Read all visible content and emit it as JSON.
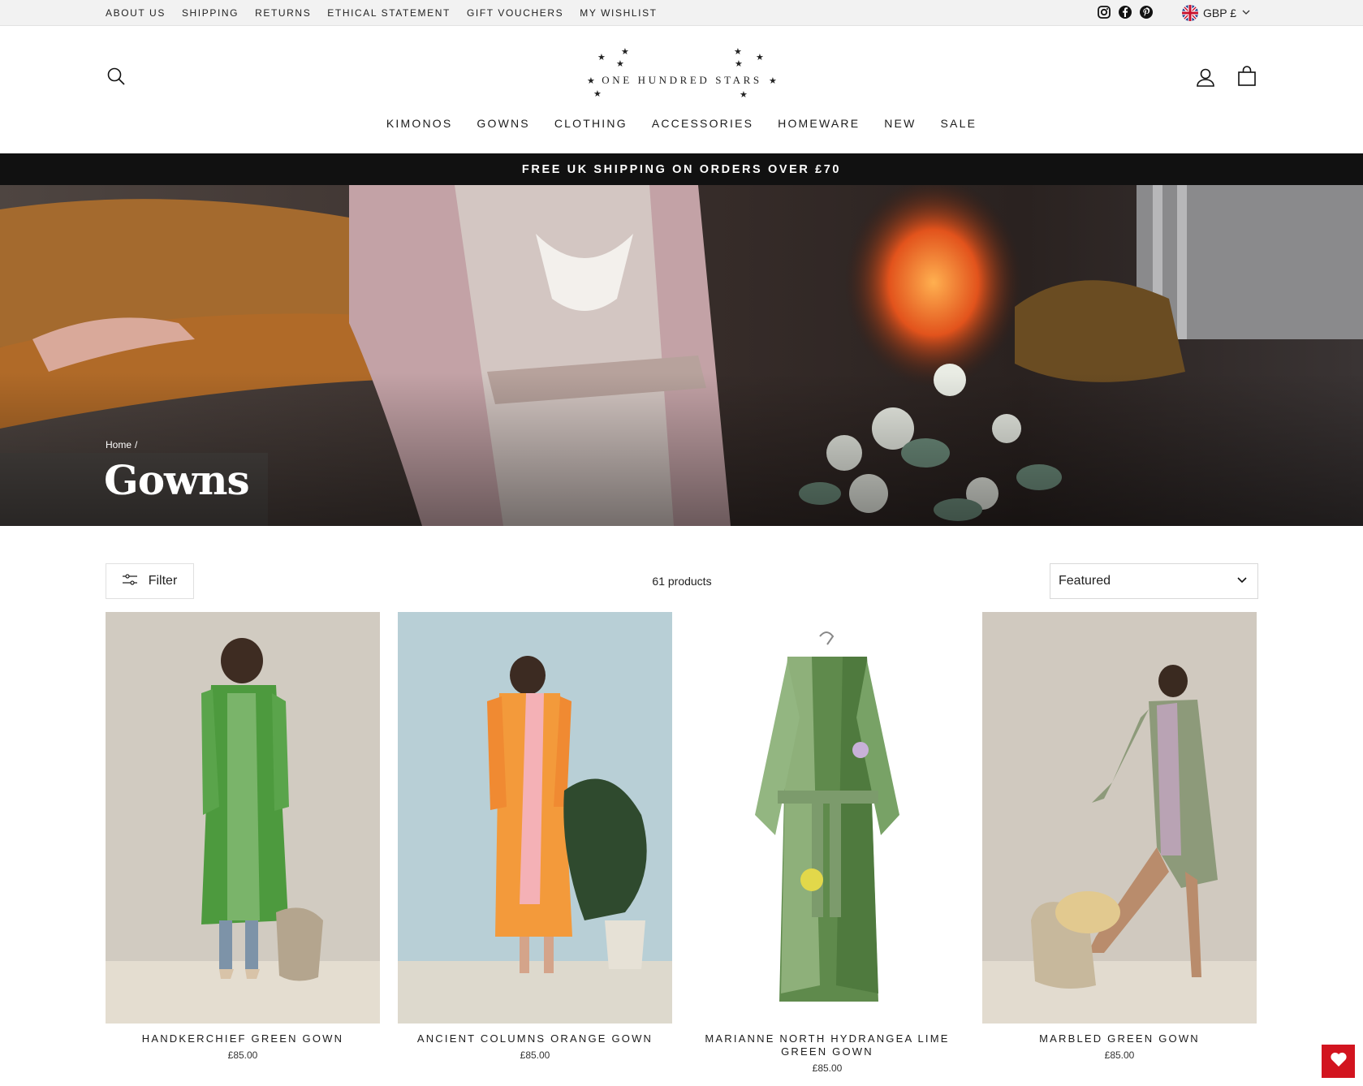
{
  "utility_nav": {
    "links": [
      "ABOUT US",
      "SHIPPING",
      "RETURNS",
      "ETHICAL STATEMENT",
      "GIFT VOUCHERS",
      "MY WISHLIST"
    ],
    "social": [
      "instagram-icon",
      "facebook-icon",
      "pinterest-icon"
    ],
    "currency": "GBP £"
  },
  "header": {
    "logo_text": "ONE HUNDRED STARS",
    "nav": [
      "KIMONOS",
      "GOWNS",
      "CLOTHING",
      "ACCESSORIES",
      "HOMEWARE",
      "NEW",
      "SALE"
    ]
  },
  "announcement": "FREE UK SHIPPING ON ORDERS OVER £70",
  "hero": {
    "breadcrumb_home": "Home",
    "breadcrumb_sep": "/",
    "title": "Gowns"
  },
  "toolbar": {
    "filter_label": "Filter",
    "product_count": "61 products",
    "sort_selected": "Featured"
  },
  "products": [
    {
      "name": "HANDKERCHIEF GREEN GOWN",
      "price": "£85.00"
    },
    {
      "name": "ANCIENT COLUMNS ORANGE GOWN",
      "price": "£85.00"
    },
    {
      "name": "MARIANNE NORTH HYDRANGEA LIME GREEN GOWN",
      "price": "£85.00"
    },
    {
      "name": "MARBLED GREEN GOWN",
      "price": "£85.00"
    }
  ],
  "colors": {
    "announcement_bg": "#111111",
    "utility_bg": "#f2f2f2",
    "wishlist_accent": "#d2141f"
  }
}
